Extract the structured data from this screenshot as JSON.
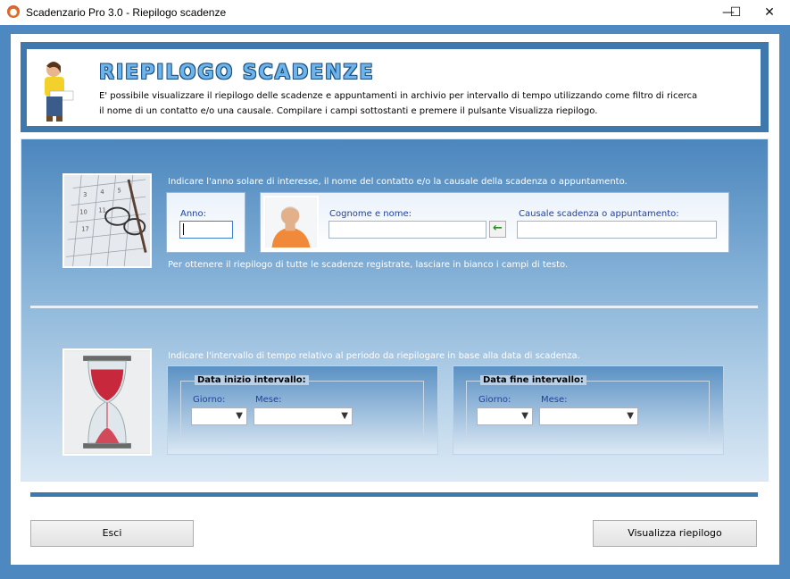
{
  "window": {
    "title": "Scadenzario Pro 3.0 - Riepilogo scadenze",
    "minimize_glyph": "—",
    "maximize_glyph": "☐",
    "close_glyph": "✕"
  },
  "header": {
    "title": "RIEPILOGO SCADENZE",
    "description_line1": "E' possibile visualizzare il riepilogo delle scadenze e appuntamenti in archivio per intervallo di tempo utilizzando come filtro di ricerca",
    "description_line2": "il nome di un contatto e/o una causale. Compilare i campi sottostanti e premere il pulsante Visualizza riepilogo."
  },
  "search": {
    "instruction": "Indicare l'anno solare di interesse, il nome del contatto e/o la causale della scadenza o appuntamento.",
    "anno_label": "Anno:",
    "anno_value": "",
    "cognome_label": "Cognome e nome:",
    "cognome_value": "",
    "arrow_glyph": "←",
    "causale_label": "Causale scadenza o appuntamento:",
    "causale_value": "",
    "note": "Per ottenere il riepilogo di tutte le scadenze registrate, lasciare in bianco i campi di testo."
  },
  "interval": {
    "instruction": "Indicare l'intervallo di tempo relativo al periodo da riepilogare in base alla data di scadenza.",
    "start": {
      "legend": "Data inizio intervallo:",
      "giorno_label": "Giorno:",
      "giorno_value": "",
      "mese_label": "Mese:",
      "mese_value": ""
    },
    "end": {
      "legend": "Data fine intervallo:",
      "giorno_label": "Giorno:",
      "giorno_value": "",
      "mese_label": "Mese:",
      "mese_value": ""
    }
  },
  "buttons": {
    "exit": "Esci",
    "view": "Visualizza riepilogo"
  },
  "colors": {
    "frame": "#4d88c0",
    "header_frame": "#3f78ad",
    "label_blue": "#1f3fa8"
  }
}
